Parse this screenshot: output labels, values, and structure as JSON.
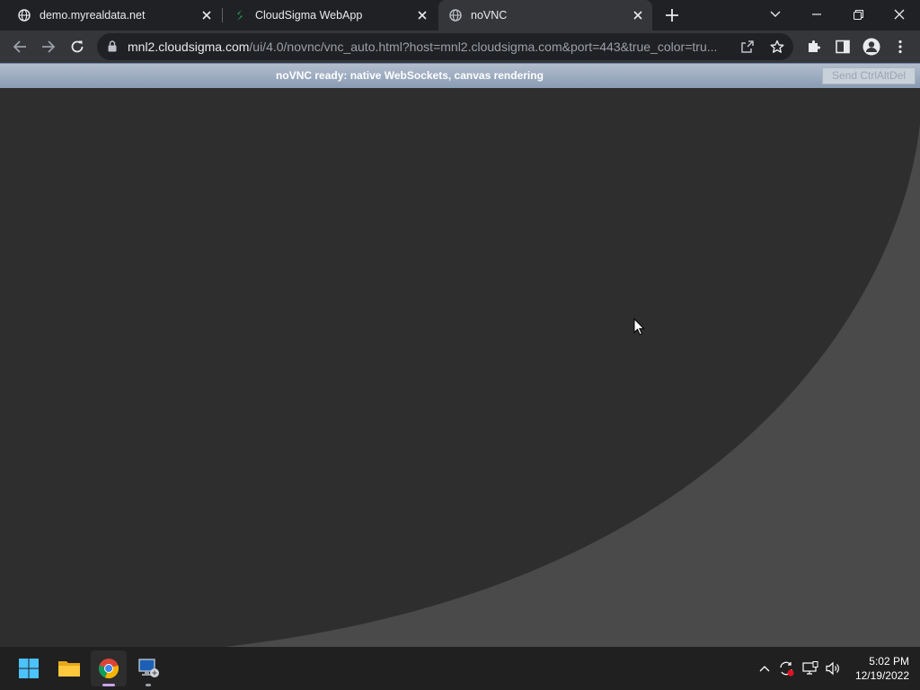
{
  "browser": {
    "tabs": [
      {
        "title": "demo.myrealdata.net",
        "icon": "globe-icon",
        "active": false
      },
      {
        "title": "CloudSigma WebApp",
        "icon": "cloudsigma-logo-icon",
        "active": false
      },
      {
        "title": "noVNC",
        "icon": "globe-icon",
        "active": true
      }
    ],
    "url_host": "mnl2.cloudsigma.com",
    "url_path": "/ui/4.0/novnc/vnc_auto.html?host=mnl2.cloudsigma.com&port=443&true_color=tru..."
  },
  "novnc": {
    "status": "noVNC ready: native WebSockets, canvas rendering",
    "send_cad_label": "Send CtrlAltDel"
  },
  "taskbar": {
    "apps": [
      "windows-start-icon",
      "file-explorer-icon",
      "chrome-icon",
      "remote-desktop-icon"
    ],
    "clock_time": "5:02 PM",
    "clock_date": "12/19/2022"
  },
  "colors": {
    "desktop_dark": "#2e2e2e",
    "desktop_light": "#4a4a4a",
    "novnc_bar": "#a3b2c4",
    "cloudsigma_green": "#1fb25a"
  }
}
